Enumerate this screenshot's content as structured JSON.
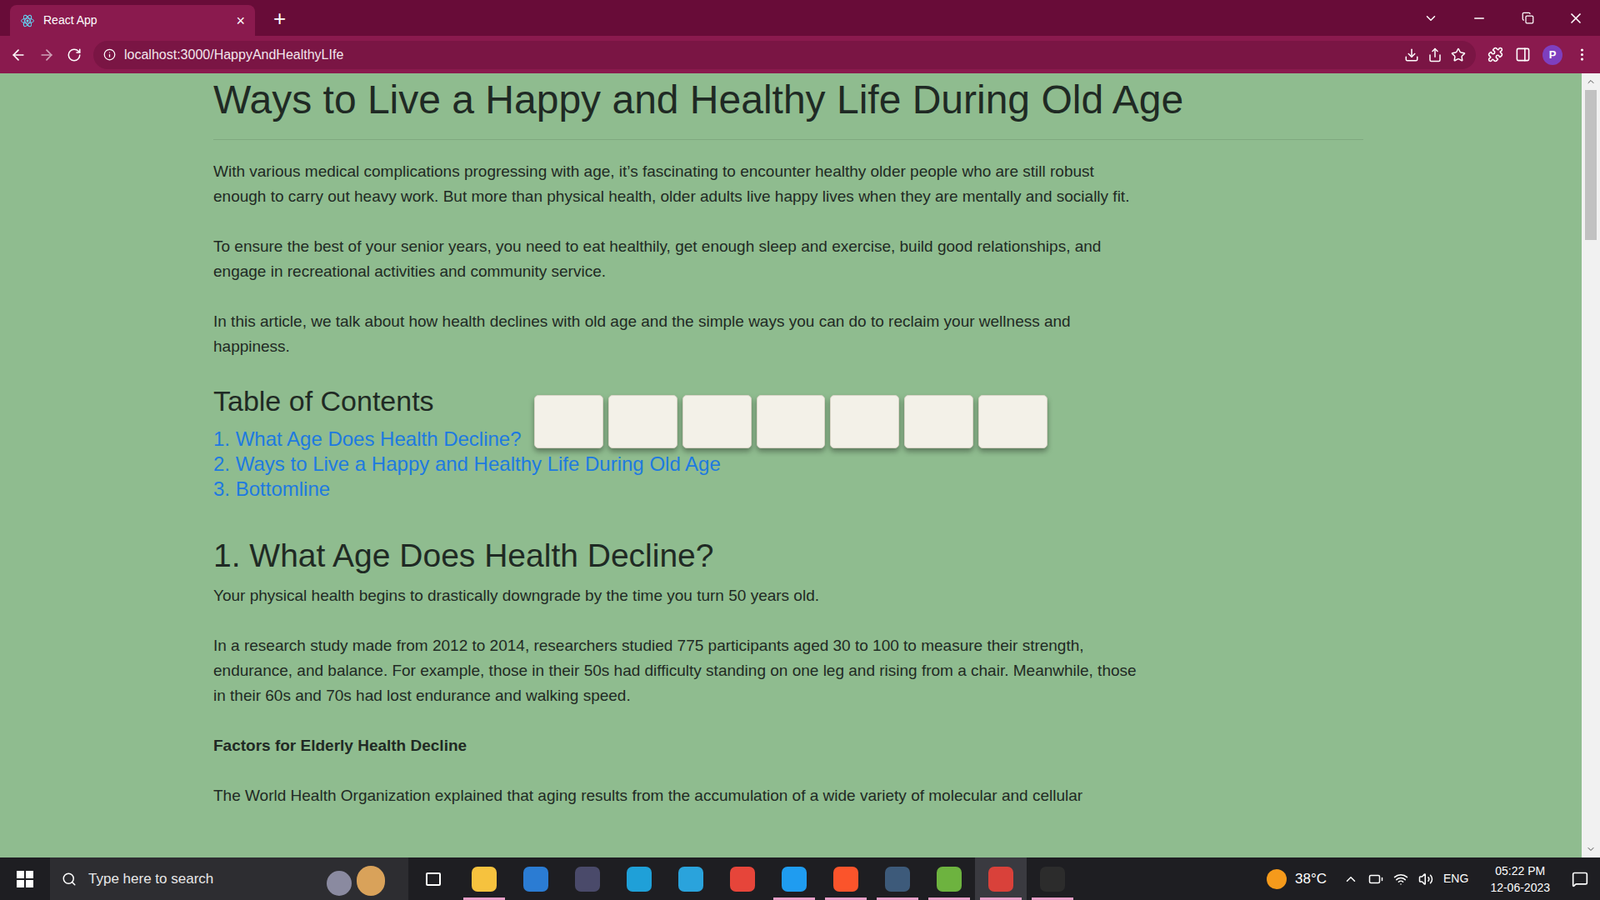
{
  "browser": {
    "tabs": [
      {
        "label": "React App",
        "selected": true,
        "close": "×"
      }
    ],
    "new_tab": "+",
    "address": "localhost:3000/HappyAndHealthyLIfe",
    "profile": "P"
  },
  "article": {
    "title": "Ways to Live a Happy and Healthy Life During Old Age",
    "intro": [
      "With various medical complications progressing with age, it’s fascinating to encounter healthy older people who are still robust enough to carry out heavy work. But more than physical health, older adults live happy lives when they are mentally and socially fit.",
      "To ensure the best of your senior years, you need to eat healthily, get enough sleep and exercise, build good relationships, and engage in recreational activities and community service.",
      "In this article, we talk about how health declines with old age and the simple ways you can do to reclaim your wellness and happiness."
    ],
    "toc": {
      "heading": "Table of Contents",
      "items": [
        "1. What Age Does Health Decline?",
        "2. Ways to Live a Happy and Healthy Life During Old Age",
        "3. Bottomline"
      ]
    },
    "section": {
      "heading": "1. What Age Does Health Decline?",
      "paragraphs": [
        "Your physical health begins to drastically downgrade by the time you turn 50 years old.",
        "In a research study made from 2012 to 2014, researchers studied 775 participants aged 30 to 100 to measure their strength, endurance, and balance. For example, those in their 50s had difficulty standing on one leg and rising from a chair. Meanwhile, those in their 60s and 70s had lost endurance and walking speed."
      ],
      "subheading": "Factors for Elderly Health Decline",
      "cut_paragraph": "The World Health Organization explained that aging results from the accumulation of a wide variety of molecular and cellular"
    }
  },
  "scrollbar": {
    "level": 0.2
  },
  "taskbar": {
    "search_placeholder": "Type here to search",
    "apps": [
      {
        "name": "file-explorer",
        "color": "#f6c23e",
        "running": true,
        "selected": false
      },
      {
        "name": "mail",
        "color": "#2b7cd3",
        "running": false,
        "selected": false
      },
      {
        "name": "eclipse",
        "color": "#4a4a6a",
        "running": false,
        "selected": false
      },
      {
        "name": "edge",
        "color": "#1fa0d8",
        "running": false,
        "selected": false
      },
      {
        "name": "telegram",
        "color": "#2aa3dc",
        "running": false,
        "selected": false
      },
      {
        "name": "chrome",
        "color": "#e6453a",
        "running": false,
        "selected": false
      },
      {
        "name": "vscode",
        "color": "#1f9cf0",
        "running": true,
        "selected": false
      },
      {
        "name": "brave",
        "color": "#fb542b",
        "running": true,
        "selected": false
      },
      {
        "name": "mysql-workbench",
        "color": "#3d5a7a",
        "running": true,
        "selected": false
      },
      {
        "name": "spring-tool-suite",
        "color": "#6db33f",
        "running": true,
        "selected": false
      },
      {
        "name": "chrome-profile",
        "color": "#d9413a",
        "running": true,
        "selected": true
      },
      {
        "name": "terminal",
        "color": "#2c2c2c",
        "running": true,
        "selected": false
      }
    ],
    "temperature": "38°C",
    "language": "ENG",
    "time": "05:22 PM",
    "date": "12-06-2023"
  }
}
